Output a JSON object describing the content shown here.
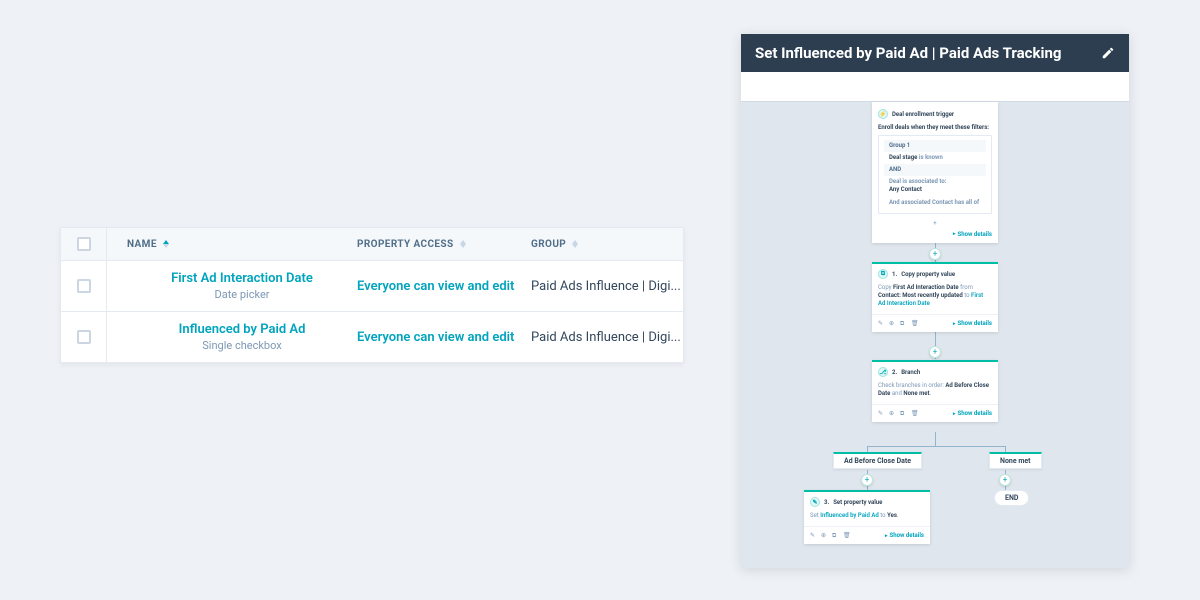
{
  "table": {
    "headers": {
      "name": "NAME",
      "access": "PROPERTY ACCESS",
      "group": "GROUP"
    },
    "rows": [
      {
        "name": "First Ad Interaction Date",
        "type": "Date picker",
        "access": "Everyone can view and edit",
        "group": "Paid Ads Influence | Digi..."
      },
      {
        "name": "Influenced by Paid Ad",
        "type": "Single checkbox",
        "access": "Everyone can view and edit",
        "group": "Paid Ads Influence | Digi..."
      }
    ]
  },
  "workflow": {
    "title": "Set Influenced by Paid Ad | Paid Ads Tracking",
    "trigger": {
      "heading": "Deal enrollment trigger",
      "intro": "Enroll deals when they meet these filters:",
      "group_label": "Group 1",
      "line1_a": "Deal stage",
      "line1_b": "is known",
      "and": "AND",
      "line2_a": "Deal is associated to:",
      "line2_b": "Any Contact",
      "line3": "And associated Contact has all of",
      "show": "Show details"
    },
    "step1": {
      "num": "1.",
      "name": "Copy property value",
      "body_a": "Copy",
      "body_b": "First Ad Interaction Date",
      "body_c": "from",
      "body_d": "Contact: Most recently updated",
      "body_e": "to",
      "body_f": "First Ad Interaction Date",
      "show": "Show details"
    },
    "step2": {
      "num": "2.",
      "name": "Branch",
      "body_a": "Check branches in order:",
      "body_b": "Ad Before Close Date",
      "body_c": "and",
      "body_d": "None met",
      "show": "Show details"
    },
    "branches": {
      "left": "Ad Before Close Date",
      "right": "None met"
    },
    "step3": {
      "num": "3.",
      "name": "Set property value",
      "body_a": "Set",
      "body_b": "Influenced by Paid Ad",
      "body_c": "to",
      "body_d": "Yes",
      "show": "Show details"
    },
    "end": "END"
  }
}
